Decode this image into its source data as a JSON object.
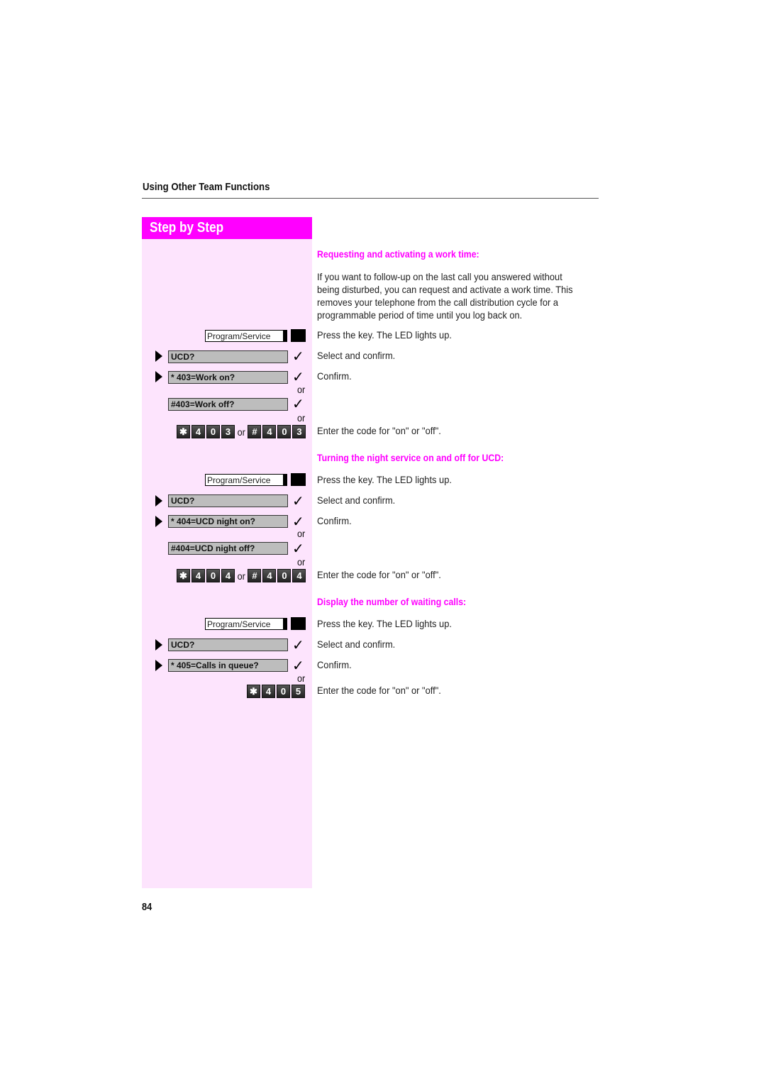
{
  "header": {
    "section_title": "Using Other Team Functions",
    "step_by_step_label": "Step by Step"
  },
  "colors": {
    "accent": "#ff00ff",
    "sidebar_bg": "#fde4fd",
    "display_bg": "#bdbdbd"
  },
  "sections": [
    {
      "heading": "Requesting and activating a work time:",
      "intro": "If you want to follow-up on the last call you answered without being disturbed, you can request and activate a work time. This removes your telephone from the call distribution cycle for a programmable period of time until you log back on.",
      "key_label": "Program/Service",
      "display_select": "UCD?",
      "display_on": "* 403=Work on?",
      "display_off": "#403=Work off?",
      "or_label": "or",
      "keys_on": [
        "*",
        "4",
        "0",
        "3"
      ],
      "keys_off": [
        "#",
        "4",
        "0",
        "3"
      ],
      "steps": {
        "press_key": "Press the key. The LED lights up.",
        "select_confirm": "Select and confirm.",
        "confirm": "Confirm.",
        "enter_code": "Enter the code for \"on\" or \"off\"."
      }
    },
    {
      "heading": "Turning the night service on and off for UCD:",
      "key_label": "Program/Service",
      "display_select": "UCD?",
      "display_on": "* 404=UCD night on?",
      "display_off": "#404=UCD night off?",
      "or_label": "or",
      "keys_on": [
        "*",
        "4",
        "0",
        "4"
      ],
      "keys_off": [
        "#",
        "4",
        "0",
        "4"
      ],
      "steps": {
        "press_key": "Press the key. The LED lights up.",
        "select_confirm": "Select and confirm.",
        "confirm": "Confirm.",
        "enter_code": "Enter the code for \"on\" or \"off\"."
      }
    },
    {
      "heading": "Display the number of waiting calls:",
      "key_label": "Program/Service",
      "display_select": "UCD?",
      "display_on": "* 405=Calls in queue?",
      "or_label": "or",
      "keys_on": [
        "*",
        "4",
        "0",
        "5"
      ],
      "steps": {
        "press_key": "Press the key. The LED lights up.",
        "select_confirm": "Select and confirm.",
        "confirm": "Confirm.",
        "enter_code": "Enter the code for \"on\" or \"off\"."
      }
    }
  ],
  "icons": {
    "check": "✓",
    "star_key": "✱",
    "hash_key": "#"
  },
  "footer": {
    "page_number": "84"
  }
}
